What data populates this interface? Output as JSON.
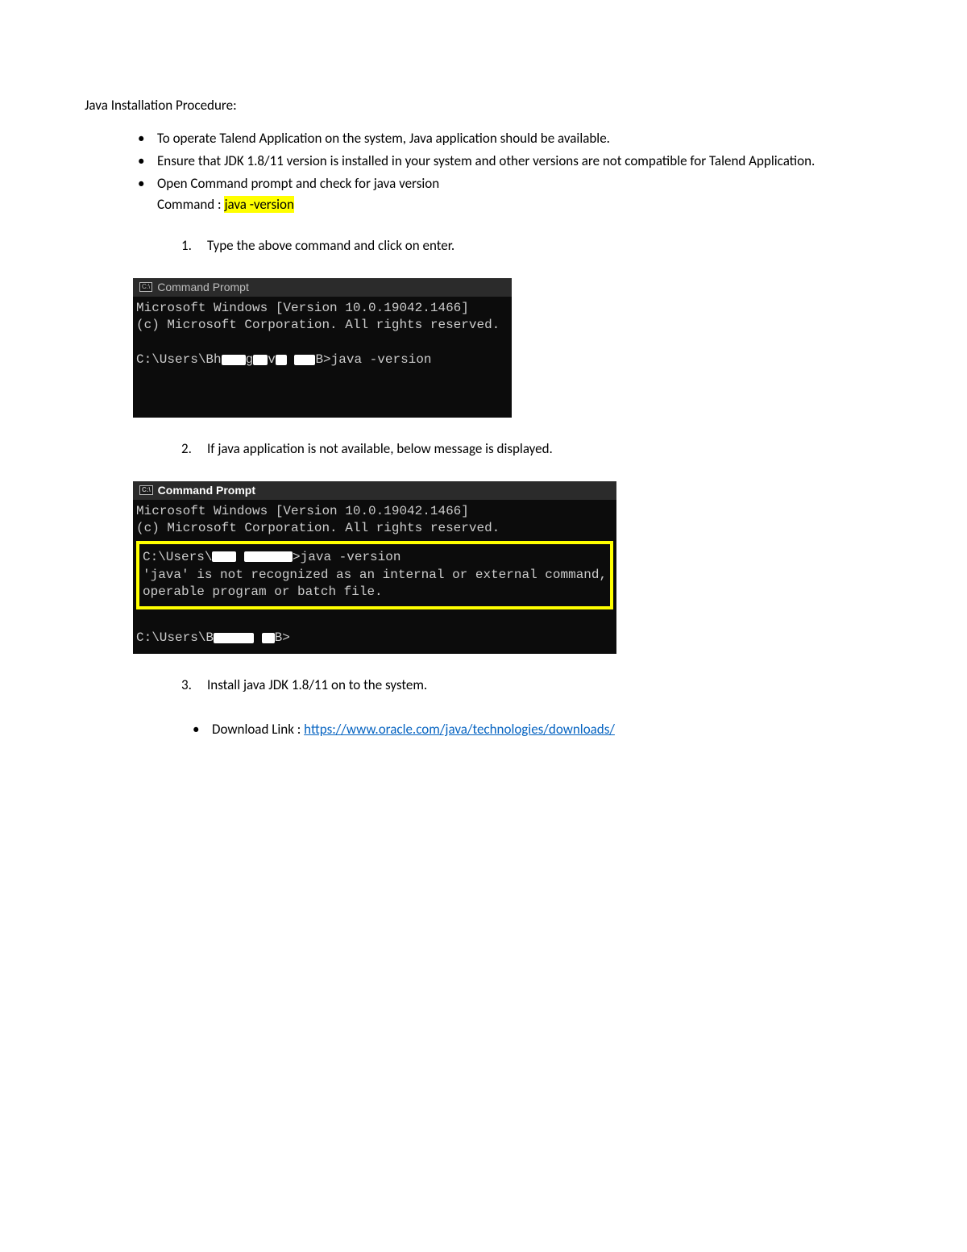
{
  "title": "Java Installation Procedure:",
  "bullets": {
    "b1": "To operate Talend Application on the system, Java application should be available.",
    "b2": "Ensure that JDK 1.8/11 version is installed in your system and other versions are not compatible for Talend Application.",
    "b3": "Open Command prompt and check for java version",
    "cmd_label": "Command :  ",
    "cmd_text": "java -version"
  },
  "steps": {
    "s1": "Type the above command and click on enter.",
    "s2": "If java application is not available, below message is displayed.",
    "s3": "Install java JDK 1.8/11 on to the system."
  },
  "terminal1": {
    "title": "Command Prompt",
    "line1a": "Microsoft Windows [Version 10.0.19042.1466]",
    "line1b": "(c) Microsoft Corporation. All rights reserved.",
    "prompt_pre": "C:\\Users\\Bh",
    "prompt_mid1": "g",
    "prompt_mid2": "v",
    "prompt_end": "B>java -version"
  },
  "terminal2": {
    "title": "Command Prompt",
    "line1a": "Microsoft Windows [Version 10.0.19042.1466]",
    "line1b": "(c) Microsoft Corporation. All rights reserved.",
    "box_p1_pre": "C:\\Users\\",
    "box_p1_post": ">java -version",
    "box_err1": "'java' is not recognized as an internal or external command,",
    "box_err2": "operable program or batch file.",
    "last_pre": "C:\\Users\\B",
    "last_post": "B>"
  },
  "download": {
    "label": "Download Link : ",
    "url": "https://www.oracle.com/java/technologies/downloads/"
  }
}
